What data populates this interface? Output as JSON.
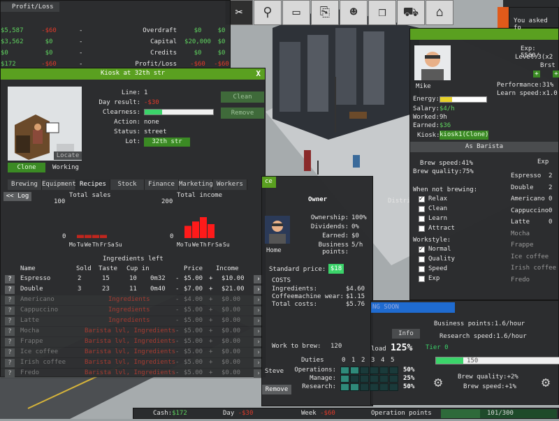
{
  "profit_panel": {
    "title": "Profit/Loss",
    "left_rows": [
      [
        "$5,587",
        "-$60",
        "-"
      ],
      [
        "$3,562",
        "$0",
        "-"
      ],
      [
        "$0",
        "$0",
        "-"
      ],
      [
        "$172",
        "-$60",
        "-"
      ]
    ],
    "right_rows": [
      [
        "Overdraft",
        "$0",
        "$0"
      ],
      [
        "Capital",
        "$20,000",
        "$0"
      ],
      [
        "Credits",
        "$0",
        "$0"
      ],
      [
        "Profit/Loss",
        "-$60",
        "-$60"
      ]
    ]
  },
  "kiosk": {
    "title": "Kiosk at 32th str",
    "close": "X",
    "info": [
      {
        "label": "Line:",
        "value": "1"
      },
      {
        "label": "Day result:",
        "value": "-$30"
      },
      {
        "label": "Clearness:",
        "value": ""
      },
      {
        "label": "Action:",
        "value": "none"
      },
      {
        "label": "Status:",
        "value": "street"
      },
      {
        "label": "Lot:",
        "value": "32th str"
      }
    ],
    "clearness_fraction": 0.25,
    "clean_btn": "Clean",
    "remove_btn": "Remove",
    "locate_btn": "Locate",
    "clone_btn": "Clone",
    "working_label": "Working",
    "tabs": [
      "Brewing",
      "Equipment",
      "Recipes",
      "Stock",
      "Finance",
      "Marketing",
      "Workers"
    ],
    "log_btn": "<< Log",
    "sales_title": "Total sales",
    "income_title": "Total income",
    "sales_ymax": "100",
    "income_ymax": "200",
    "zero": "0",
    "days": [
      "Mo",
      "Tu",
      "We",
      "Th",
      "Fr",
      "Sa",
      "Su"
    ],
    "ingredients_left": "Ingredients left",
    "table_headers": [
      "Name",
      "Sold",
      "Taste",
      "Cup in",
      "Price",
      "Income"
    ],
    "recipes": [
      {
        "name": "Espresso",
        "sold": "2",
        "taste": "15",
        "cupA": "10",
        "cupB": "0m32",
        "price": "$5.00",
        "income": "$10.00",
        "active": true
      },
      {
        "name": "Double",
        "sold": "3",
        "taste": "23",
        "cupA": "11",
        "cupB": "0m40",
        "price": "$7.00",
        "income": "$21.00",
        "active": true
      },
      {
        "name": "Americano",
        "req": "Ingredients",
        "price": "$4.00",
        "income": "$0.00",
        "active": false
      },
      {
        "name": "Cappuccino",
        "req": "Ingredients",
        "price": "$5.00",
        "income": "$0.00",
        "active": false
      },
      {
        "name": "Latte",
        "req": "Ingredients",
        "price": "$5.00",
        "income": "$0.00",
        "active": false
      },
      {
        "name": "Mocha",
        "req": "Barista lvl, Ingredients",
        "price": "$5.00",
        "income": "$0.00",
        "active": false
      },
      {
        "name": "Frappe",
        "req": "Barista lvl, Ingredients",
        "price": "$5.00",
        "income": "$0.00",
        "active": false
      },
      {
        "name": "Ice coffee",
        "req": "Barista lvl, Ingredients",
        "price": "$5.00",
        "income": "$0.00",
        "active": false
      },
      {
        "name": "Irish coffee",
        "req": "Barista lvl, Ingredients",
        "price": "$5.00",
        "income": "$0.00",
        "active": false
      },
      {
        "name": "Fredo",
        "req": "Barista lvl, Ingredients",
        "price": "$5.00",
        "income": "$0.00",
        "active": false
      }
    ]
  },
  "chart_data": [
    {
      "type": "bar",
      "title": "Total sales",
      "categories": [
        "Mo",
        "Tu",
        "We",
        "Th",
        "Fr",
        "Sa",
        "Su"
      ],
      "values": [
        0,
        9,
        9,
        9,
        9,
        0,
        0
      ],
      "ylim": [
        0,
        100
      ]
    },
    {
      "type": "bar",
      "title": "Total income",
      "categories": [
        "Mo",
        "Tu",
        "We",
        "Th",
        "Fr",
        "Sa",
        "Su"
      ],
      "values": [
        0,
        70,
        95,
        120,
        80,
        0,
        0
      ],
      "ylim": [
        0,
        200
      ]
    }
  ],
  "owner": {
    "title": "Owner",
    "banner": "ce",
    "name": "Home",
    "rows": [
      [
        "Ownership:",
        "100%"
      ],
      [
        "Dividends:",
        "0%"
      ],
      [
        "Earned:",
        "$0"
      ],
      [
        "Business points:",
        "5/h"
      ]
    ],
    "distr": "Distri",
    "standard_price_label": "Standard price:",
    "standard_price_value": "$18",
    "costs_title": "COSTS",
    "costs": [
      [
        "Ingredients:",
        "$4.60"
      ],
      [
        "Coffeemachine wear:",
        "$1.15"
      ],
      [
        "Total costs:",
        "$5.76"
      ]
    ],
    "work_label": "Work to brew:",
    "work_value": "120",
    "steve": "Steve",
    "remove": "Remove"
  },
  "barista": {
    "name": "Mike",
    "exp": "Exp: 5560/",
    "level": "Level:3(x2",
    "brst": "Brst",
    "perf_label": "Performance:",
    "perf": "31%",
    "learn_label": "Learn speed:",
    "learn": "x1.0",
    "energy_label": "Energy:",
    "energy_fraction": 0.25,
    "salary_label": "Salary:",
    "salary": "$4/h",
    "worked_label": "Worked:",
    "worked": "9h",
    "earned_label": "Earned:",
    "earned": "$36",
    "kiosk_label": "Kiosk:",
    "kiosk": "kiosk1(Clone)",
    "as_label": "As Barista",
    "exp_short": "Exp",
    "brew_speed": "Brew speed:",
    "brew_speed_val": "41%",
    "brew_quality": "Brew quality:",
    "brew_quality_val": "75%",
    "when_not": "When not brewing:",
    "idle_options": [
      {
        "label": "Relax",
        "on": true
      },
      {
        "label": "Clean",
        "on": false
      },
      {
        "label": "Learn",
        "on": false
      },
      {
        "label": "Attract",
        "on": false
      }
    ],
    "workstyle": "Workstyle:",
    "style_options": [
      {
        "label": "Normal",
        "on": true
      },
      {
        "label": "Quality",
        "on": false
      },
      {
        "label": "Speed",
        "on": false
      },
      {
        "label": "Exp",
        "on": false
      }
    ],
    "skills": [
      {
        "name": "Espresso",
        "lvl": "2",
        "on": true
      },
      {
        "name": "Double",
        "lvl": "2",
        "on": true
      },
      {
        "name": "Americano",
        "lvl": "0",
        "on": true
      },
      {
        "name": "Cappuccino",
        "lvl": "0",
        "on": true
      },
      {
        "name": "Latte",
        "lvl": "0",
        "on": true
      },
      {
        "name": "Mocha",
        "lvl": "",
        "on": false
      },
      {
        "name": "Frappe",
        "lvl": "",
        "on": false
      },
      {
        "name": "Ice coffee",
        "lvl": "",
        "on": false
      },
      {
        "name": "Irish coffee",
        "lvl": "",
        "on": false
      },
      {
        "name": "Fredo",
        "lvl": "",
        "on": false
      }
    ]
  },
  "research": {
    "soon": "NG SOON",
    "info": "Info",
    "load_label": "load",
    "load": "125%",
    "biz": "Business points:1.6/hour",
    "res": "Research speed:1.6/hour",
    "tier": "Tier 0",
    "tier_val": "150",
    "duties": "Duties",
    "duty_cols": [
      "0",
      "1",
      "2",
      "3",
      "4",
      "5"
    ],
    "duty_rows": [
      [
        "Operations:",
        "50%"
      ],
      [
        "Manage:",
        "25%"
      ],
      [
        "Research:",
        "50%"
      ]
    ],
    "bq": "Brew quality:+2%",
    "bs": "Brew speed:+1%"
  },
  "dialog": "You asked fo",
  "bottom": {
    "cash_label": "Cash:",
    "cash": "$172",
    "day_label": "Day",
    "day": "-$30",
    "week_label": "Week",
    "week": "-$60",
    "op_label": "Operation points",
    "op": "101/300"
  }
}
